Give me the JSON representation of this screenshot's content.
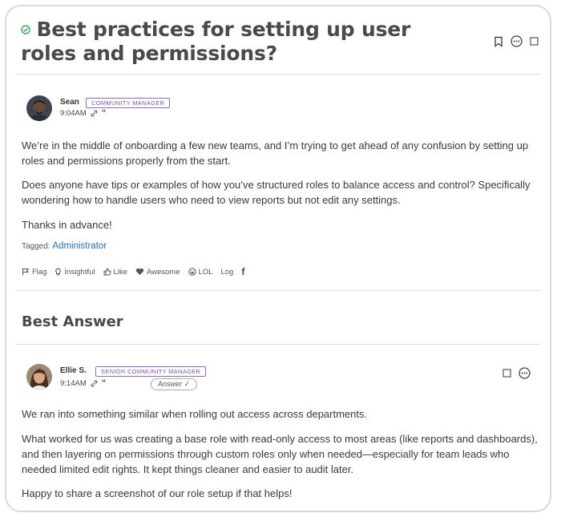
{
  "question": {
    "title": "Best practices for setting up user roles and permissions?",
    "author": "Sean",
    "role_badge": "COMMUNITY MANAGER",
    "time": "9:04AM",
    "paragraphs": [
      "We’re in the middle of onboarding a few new teams, and I’m trying to get ahead of any confusion by setting up roles and permissions properly from the start.",
      "Does anyone have tips or examples of how you’ve structured roles to balance access and control? Specifically wondering how to handle users who need to view reports but not edit any settings.",
      "Thanks in advance!"
    ],
    "tagged_label": "Tagged:",
    "tag": "Administrator",
    "reactions": {
      "flag": "Flag",
      "insightful": "Insightful",
      "like": "Like",
      "awesome": "Awesome",
      "lol": "LOL",
      "log": "Log",
      "facebook": "f"
    }
  },
  "best_answer": {
    "heading": "Best Answer",
    "author": "Ellie S.",
    "role_badge": "SENIOR COMMUNITY MANAGER",
    "time": "9:14AM",
    "answer_pill": "Answer ✓",
    "paragraphs": [
      "We ran into something similar when rolling out access across departments.",
      "What worked for us was creating a base role with read-only access to most areas (like reports and dashboards), and then layering on permissions through custom roles only when needed—especially for team leads who needed limited edit rights. It kept things cleaner and easier to audit later.",
      "Happy to share a screenshot of our role setup if that helps!"
    ]
  },
  "colors": {
    "accent_green": "#3aa655",
    "badge_purple": "#7a58b0",
    "link_blue": "#2a6fb5"
  },
  "icons": [
    "check-circle-icon",
    "bookmark-icon",
    "more-options-icon",
    "checkbox-icon",
    "permalink-icon",
    "quote-icon",
    "flag-icon",
    "lightbulb-icon",
    "thumbs-up-icon",
    "heart-icon",
    "laugh-icon",
    "facebook-icon"
  ]
}
